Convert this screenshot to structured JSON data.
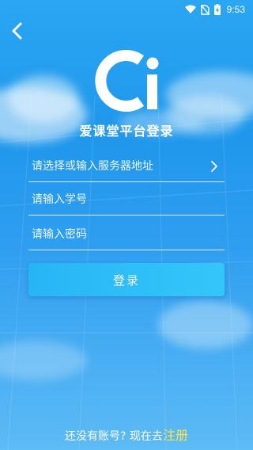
{
  "status_bar": {
    "time": "9:53",
    "icons": [
      "wifi-icon",
      "sim-off-icon",
      "battery-charging-icon"
    ]
  },
  "nav": {
    "back_icon": "chevron-left-icon"
  },
  "logo": {
    "icon": "ai-logo-icon"
  },
  "title": "爱课堂平台登录",
  "form": {
    "server_placeholder": "请选择或输入服务器地址",
    "server_value": "",
    "student_id_placeholder": "请输入学号",
    "student_id_value": "",
    "password_placeholder": "请输入密码",
    "password_value": ""
  },
  "login_button": "登录",
  "footer": {
    "prompt": "还没有账号? 现在去",
    "register_link": "注册"
  },
  "colors": {
    "background": "#1f97ec",
    "button": "#2ebef8",
    "link": "#ffe24a",
    "text": "#ffffff"
  }
}
